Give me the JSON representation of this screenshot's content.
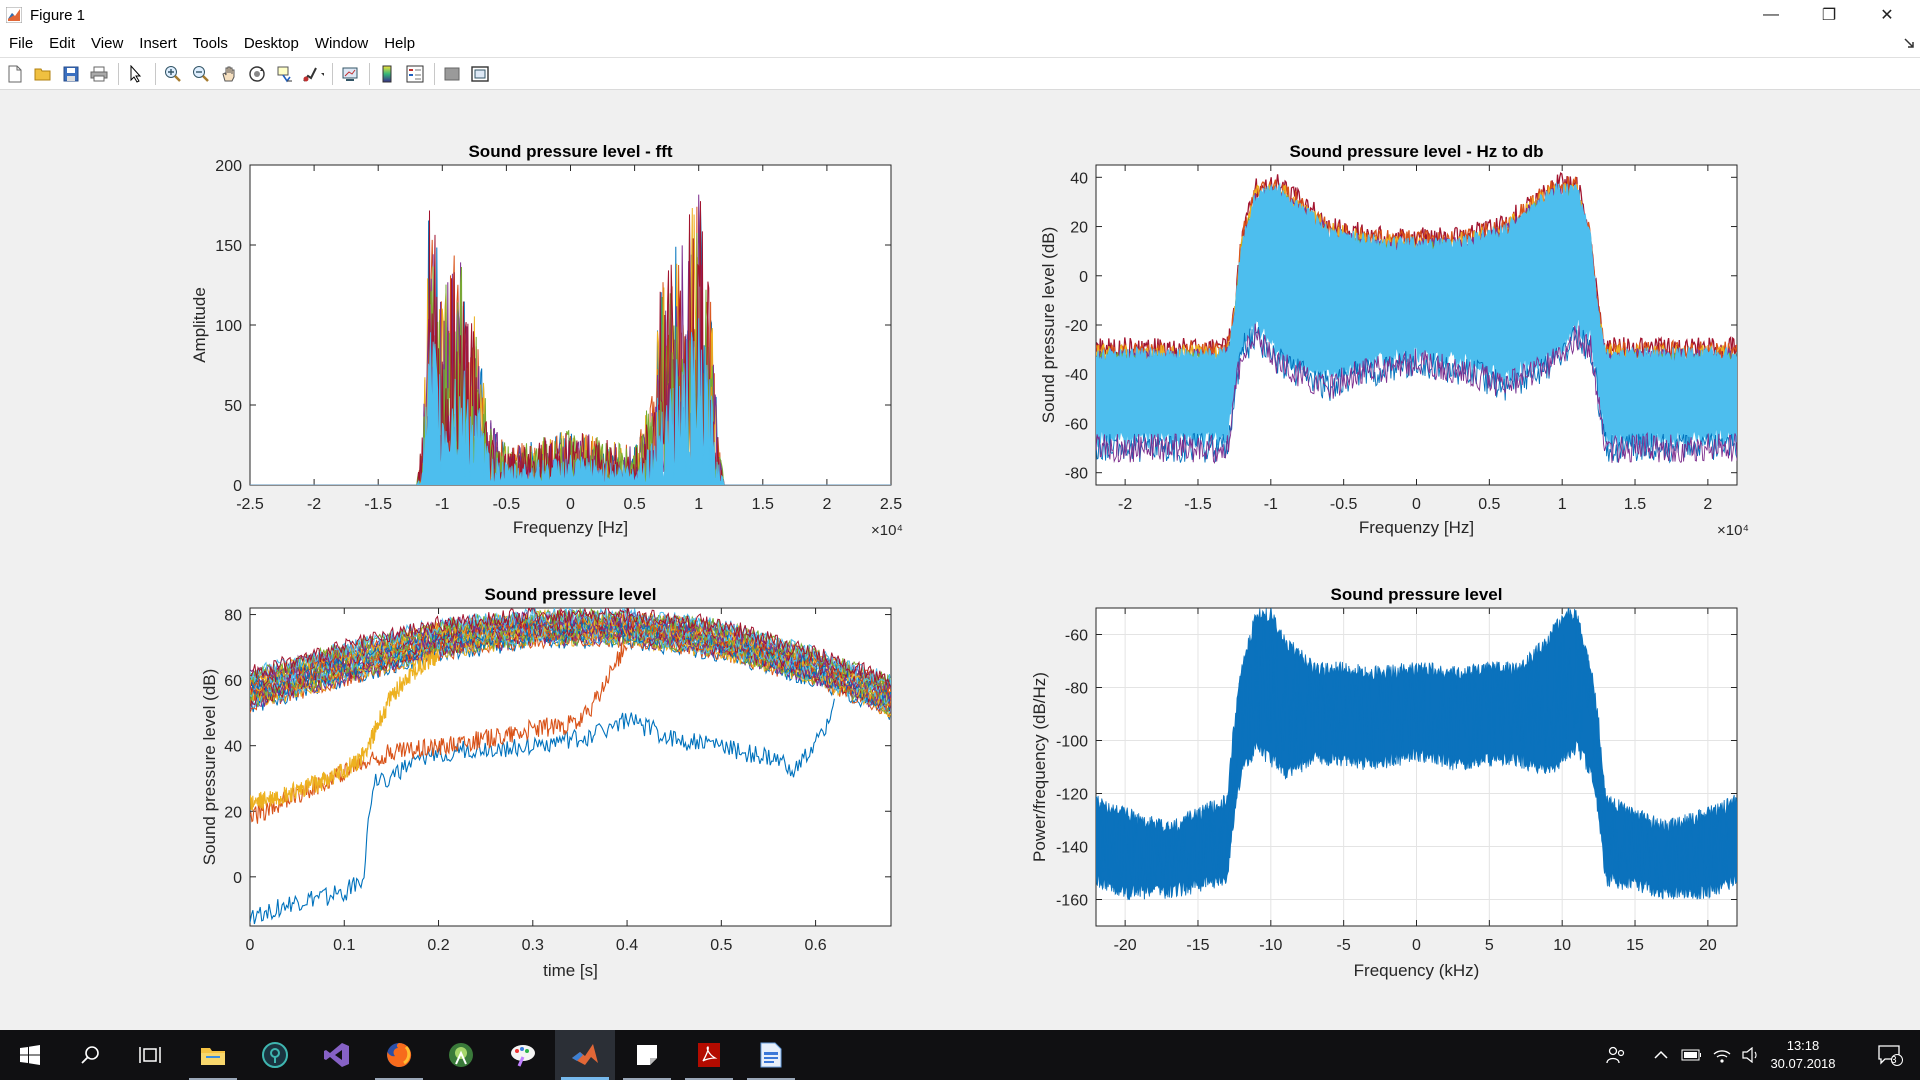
{
  "window": {
    "title": "Figure 1",
    "controls": {
      "minimize": "—",
      "restore": "❐",
      "close": "✕"
    }
  },
  "menu": [
    "File",
    "Edit",
    "View",
    "Insert",
    "Tools",
    "Desktop",
    "Window",
    "Help"
  ],
  "toolbar_icons": [
    "new-figure-icon",
    "open-file-icon",
    "save-icon",
    "print-icon",
    "edit-plot-icon",
    "zoom-in-icon",
    "zoom-out-icon",
    "pan-icon",
    "rotate-3d-icon",
    "data-cursor-icon",
    "brush-icon",
    "link-plot-icon",
    "colorbar-icon",
    "legend-icon",
    "hide-plot-tools-icon",
    "show-plot-tools-icon"
  ],
  "colors": {
    "matlab_blue": "#0072bd",
    "matlab_orange": "#d95319",
    "matlab_yellow": "#edb120",
    "matlab_purple": "#7e2f8e",
    "matlab_green": "#77ac30",
    "matlab_cyan": "#4dbeee",
    "matlab_red": "#a2142f"
  },
  "chart_data": [
    {
      "type": "line",
      "title": "Sound pressure level - fft",
      "xlabel": "Frequenzy [Hz]",
      "ylabel": "Amplitude",
      "x_exponent": "×10⁴",
      "xlim": [
        -2.5,
        2.5
      ],
      "ylim": [
        0,
        200
      ],
      "xticks": [
        "-2.5",
        "-2",
        "-1.5",
        "-1",
        "-0.5",
        "0",
        "0.5",
        "1",
        "1.5",
        "2",
        "2.5"
      ],
      "yticks": [
        "0",
        "50",
        "100",
        "150",
        "200"
      ],
      "grid": false,
      "envelope": {
        "x": [
          -2.5,
          -1.2,
          -1.15,
          -1.1,
          -1.05,
          -1.0,
          -0.9,
          -0.8,
          -0.7,
          -0.65,
          -0.5,
          -0.3,
          0,
          0.3,
          0.5,
          0.65,
          0.7,
          0.8,
          0.9,
          1.0,
          1.05,
          1.1,
          1.15,
          1.2,
          2.5
        ],
        "peak_y": [
          0,
          0,
          35,
          190,
          165,
          120,
          150,
          130,
          85,
          45,
          25,
          28,
          35,
          28,
          25,
          60,
          130,
          145,
          165,
          190,
          160,
          110,
          35,
          0,
          0
        ]
      }
    },
    {
      "type": "line",
      "title": "Sound pressure level - Hz to db",
      "xlabel": "Frequenzy [Hz]",
      "ylabel": "Sound pressure level (dB)",
      "x_exponent": "×10⁴",
      "xlim": [
        -2.2,
        2.2
      ],
      "ylim": [
        -85,
        45
      ],
      "xticks": [
        "-2",
        "-1.5",
        "-1",
        "-0.5",
        "0",
        "0.5",
        "1",
        "1.5",
        "2"
      ],
      "yticks": [
        "-80",
        "-60",
        "-40",
        "-20",
        "0",
        "20",
        "40"
      ],
      "grid": false,
      "envelope": {
        "x": [
          -2.2,
          -1.3,
          -1.25,
          -1.2,
          -1.1,
          -0.95,
          -0.8,
          -0.6,
          -0.4,
          -0.2,
          0,
          0.2,
          0.4,
          0.6,
          0.8,
          0.95,
          1.1,
          1.2,
          1.25,
          1.3,
          2.2
        ],
        "upper_y": [
          -25,
          -25,
          -10,
          20,
          40,
          42,
          35,
          25,
          22,
          20,
          20,
          20,
          22,
          25,
          35,
          42,
          42,
          20,
          -10,
          -25,
          -25
        ],
        "lower_y": [
          -70,
          -70,
          -50,
          -30,
          -25,
          -35,
          -40,
          -45,
          -40,
          -38,
          -35,
          -38,
          -40,
          -45,
          -40,
          -35,
          -25,
          -30,
          -50,
          -70,
          -70
        ]
      }
    },
    {
      "type": "line",
      "title": "Sound pressure level",
      "xlabel": "time [s]",
      "ylabel": "Sound pressure level (dB)",
      "xlim": [
        0,
        0.68
      ],
      "ylim": [
        -15,
        82
      ],
      "xticks": [
        "0",
        "0.1",
        "0.2",
        "0.3",
        "0.4",
        "0.5",
        "0.6"
      ],
      "yticks": [
        "0",
        "20",
        "40",
        "60",
        "80"
      ],
      "grid": false,
      "band": {
        "x": [
          0,
          0.1,
          0.2,
          0.3,
          0.4,
          0.5,
          0.6,
          0.68
        ],
        "upper": [
          62,
          70,
          77,
          80,
          80,
          77,
          68,
          60
        ],
        "lower": [
          52,
          60,
          68,
          72,
          72,
          68,
          60,
          50
        ]
      },
      "series": [
        {
          "x": [
            0,
            0.05,
            0.1,
            0.12,
            0.13,
            0.2,
            0.3,
            0.35,
            0.4,
            0.45,
            0.5,
            0.55,
            0.58,
            0.6,
            0.62
          ],
          "y": [
            -12,
            -8,
            -5,
            0,
            28,
            38,
            40,
            42,
            48,
            42,
            40,
            36,
            33,
            40,
            52
          ]
        },
        {
          "x": [
            0,
            0.05,
            0.1,
            0.15,
            0.2,
            0.25,
            0.3,
            0.35,
            0.37,
            0.4
          ],
          "y": [
            18,
            25,
            32,
            38,
            40,
            42,
            45,
            47,
            55,
            72
          ]
        },
        {
          "x": [
            0,
            0.05,
            0.1,
            0.12,
            0.15,
            0.17,
            0.2
          ],
          "y": [
            22,
            26,
            32,
            37,
            55,
            62,
            68
          ]
        }
      ]
    },
    {
      "type": "line",
      "title": "Sound pressure level",
      "xlabel": "Frequency (kHz)",
      "ylabel": "Power/frequency (dB/Hz)",
      "xlim": [
        -22,
        22
      ],
      "ylim": [
        -170,
        -50
      ],
      "xticks": [
        "-20",
        "-15",
        "-10",
        "-5",
        "0",
        "5",
        "10",
        "15",
        "20"
      ],
      "yticks": [
        "-160",
        "-140",
        "-120",
        "-100",
        "-80",
        "-60"
      ],
      "grid": true,
      "envelope": {
        "x": [
          -22,
          -20,
          -17,
          -13,
          -12.5,
          -12,
          -11,
          -10,
          -9,
          -7,
          -5,
          -3,
          0,
          3,
          5,
          7,
          9,
          10,
          11,
          12,
          12.5,
          13,
          17,
          20,
          22
        ],
        "upper_y": [
          -120,
          -125,
          -130,
          -120,
          -90,
          -70,
          -50,
          -50,
          -60,
          -70,
          -70,
          -72,
          -70,
          -72,
          -70,
          -70,
          -60,
          -50,
          -50,
          -70,
          -90,
          -120,
          -130,
          -125,
          -120
        ],
        "lower_y": [
          -155,
          -160,
          -160,
          -155,
          -130,
          -115,
          -105,
          -110,
          -115,
          -110,
          -110,
          -112,
          -108,
          -112,
          -110,
          -110,
          -115,
          -110,
          -105,
          -115,
          -130,
          -155,
          -160,
          -160,
          -155
        ]
      }
    }
  ],
  "taskbar": {
    "apps": [
      "start-icon",
      "search-icon",
      "task-view-icon",
      "file-explorer-icon",
      "app-icon-circle",
      "visual-studio-icon",
      "firefox-icon",
      "android-studio-icon",
      "paint-icon",
      "matlab-icon",
      "sticky-notes-icon",
      "acrobat-icon",
      "document-icon"
    ],
    "time": "13:18",
    "date": "30.07.2018",
    "notifications": "3"
  }
}
